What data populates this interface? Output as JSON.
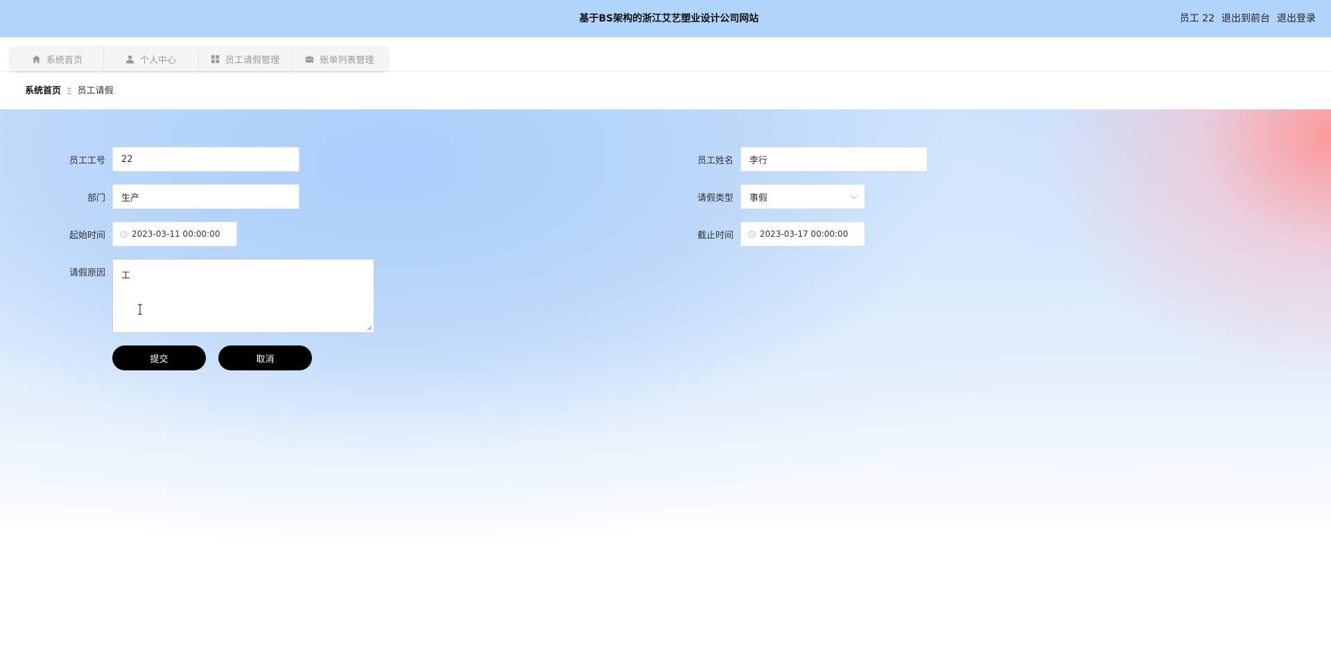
{
  "header": {
    "site_title": "基于BS架构的浙江艾艺塑业设计公司网站",
    "user_label": "员工 22",
    "back_to_front": "退出到前台",
    "logout": "退出登录",
    "background_color": "#b0d4fb"
  },
  "nav": {
    "tabs": [
      {
        "label": "系统首页",
        "icon": "home-icon"
      },
      {
        "label": "个人中心",
        "icon": "user-icon"
      },
      {
        "label": "员工请假管理",
        "icon": "grid-icon"
      },
      {
        "label": "账单列表管理",
        "icon": "briefcase-icon"
      }
    ]
  },
  "breadcrumb": {
    "home": "系统首页",
    "separator": "Ξ",
    "current": "员工请假"
  },
  "form": {
    "employee_no_label": "员工工号",
    "employee_no_value": "22",
    "employee_name_label": "员工姓名",
    "employee_name_value": "李行",
    "department_label": "部门",
    "department_value": "生产",
    "leave_type_label": "请假类型",
    "leave_type_value": "事假",
    "start_time_label": "起始时间",
    "start_time_value": "2023-03-11 00:00:00",
    "end_time_label": "截止时间",
    "end_time_value": "2023-03-17 00:00:00",
    "reason_label": "请假原因",
    "reason_value": "工",
    "submit_label": "提交",
    "cancel_label": "取消"
  }
}
